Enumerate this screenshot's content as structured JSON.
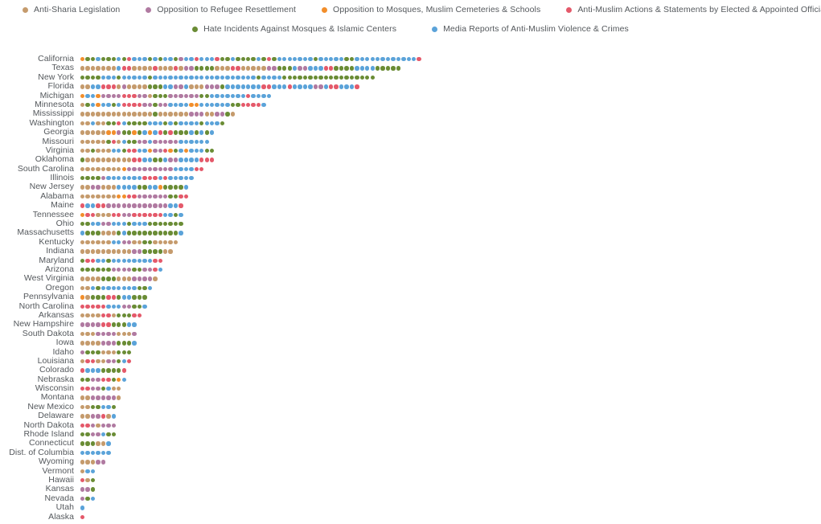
{
  "legend": {
    "rows": [
      [
        {
          "label": "Anti-Sharia Legislation",
          "key": "sharia",
          "color": "#c59b6d"
        },
        {
          "label": "Opposition to Refugee Resettlement",
          "key": "refugee",
          "color": "#b07aa1"
        },
        {
          "label": "Opposition to Mosques, Muslim Cemeteries & Schools",
          "key": "mosques",
          "color": "#f28e2b"
        },
        {
          "label": "Anti-Muslim Actions & Statements by Elected & Appointed Officials",
          "key": "officials",
          "color": "#e4596a"
        }
      ],
      [
        {
          "label": "Hate Incidents Against Mosques & Islamic Centers",
          "key": "hate",
          "color": "#6a8c35"
        },
        {
          "label": "Media Reports of Anti-Muslim Violence & Crimes",
          "key": "media",
          "color": "#5ba3d9"
        }
      ]
    ]
  },
  "chart_data": {
    "type": "bar",
    "subtype": "stacked-dot-plot",
    "title": "",
    "xlabel": "",
    "ylabel": "",
    "grid": false,
    "legend_position": "top",
    "dot_unit": 1,
    "series": [
      {
        "name": "Anti-Sharia Legislation",
        "key": "sharia",
        "color": "#c59b6d"
      },
      {
        "name": "Opposition to Refugee Resettlement",
        "key": "refugee",
        "color": "#b07aa1"
      },
      {
        "name": "Opposition to Mosques, Muslim Cemeteries & Schools",
        "key": "mosques",
        "color": "#f28e2b"
      },
      {
        "name": "Anti-Muslim Actions & Statements by Elected & Appointed Officials",
        "key": "officials",
        "color": "#e4596a"
      },
      {
        "name": "Hate Incidents Against Mosques & Islamic Centers",
        "key": "hate",
        "color": "#6a8c35"
      },
      {
        "name": "Media Reports of Anti-Muslim Violence & Crimes",
        "key": "media",
        "color": "#5ba3d9"
      }
    ],
    "categories": [
      "California",
      "Texas",
      "New York",
      "Florida",
      "Michigan",
      "Minnesota",
      "Mississippi",
      "Washington",
      "Georgia",
      "Missouri",
      "Virginia",
      "Oklahoma",
      "South Carolina",
      "Illinois",
      "New Jersey",
      "Alabama",
      "Maine",
      "Tennessee",
      "Ohio",
      "Massachusetts",
      "Kentucky",
      "Indiana",
      "Maryland",
      "Arizona",
      "West Virginia",
      "Oregon",
      "Pennsylvania",
      "North Carolina",
      "Arkansas",
      "New Hampshire",
      "South Dakota",
      "Iowa",
      "Idaho",
      "Louisiana",
      "Colorado",
      "Nebraska",
      "Wisconsin",
      "Montana",
      "New Mexico",
      "Delaware",
      "North Dakota",
      "Rhode Island",
      "Connecticut",
      "Dist. of Columbia",
      "Wyoming",
      "Vermont",
      "Hawaii",
      "Kansas",
      "Nevada",
      "Utah",
      "Alaska"
    ],
    "rows": [
      {
        "state": "California",
        "total": 66,
        "dots": "mosques,hate,hate,media,hate,hate,hate,media,hate,officials,media,media,media,hate,media,hate,media,media,hate,refugee,media,media,officials,media,media,media,officials,hate,hate,media,hate,hate,hate,hate,media,hate,officials,hate,media,media,media,media,media,media,media,hate,media,media,media,media,media,hate,hate,media,media,media,media,media,media,media,media,media,media,media,media,officials"
      },
      {
        "state": "Texas",
        "total": 62,
        "dots": "sharia,sharia,sharia,sharia,sharia,sharia,sharia,media,officials,officials,sharia,sharia,sharia,sharia,officials,sharia,sharia,sharia,officials,sharia,refugee,refugee,hate,hate,hate,hate,sharia,sharia,sharia,officials,officials,sharia,sharia,sharia,sharia,sharia,refugee,refugee,hate,hate,hate,media,refugee,refugee,media,media,media,officials,officials,hate,hate,hate,hate,media,media,media,media,hate,hate,hate,hate,hate"
      },
      {
        "state": "New York",
        "total": 57,
        "dots": "hate,hate,hate,hate,media,media,media,hate,media,media,media,media,media,hate,media,media,media,media,media,media,media,media,media,media,media,media,media,media,media,media,media,media,media,media,hate,media,media,media,media,hate,hate,hate,hate,hate,hate,hate,hate,hate,hate,hate,hate,hate,hate,hate,hate,hate,hate"
      },
      {
        "state": "Florida",
        "total": 54,
        "dots": "sharia,sharia,media,media,officials,officials,officials,sharia,refugee,sharia,sharia,sharia,sharia,hate,hate,hate,media,media,refugee,refugee,media,sharia,sharia,sharia,refugee,refugee,refugee,hate,media,media,media,media,media,media,media,officials,officials,media,media,media,officials,media,media,media,media,refugee,refugee,media,officials,officials,media,media,media,officials"
      },
      {
        "state": "Michigan",
        "total": 37,
        "dots": "mosques,media,media,mosques,refugee,refugee,refugee,refugee,officials,officials,officials,refugee,refugee,sharia,hate,hate,hate,refugee,refugee,refugee,refugee,refugee,refugee,hate,hate,media,media,media,media,media,media,media,officials,media,media,media,media"
      },
      {
        "state": "Minnesota",
        "total": 36,
        "dots": "sharia,hate,media,mosques,media,media,hate,media,officials,officials,officials,officials,refugee,refugee,hate,refugee,refugee,media,media,media,media,mosques,mosques,media,media,media,media,media,media,hate,hate,officials,officials,officials,officials,media"
      },
      {
        "state": "Mississippi",
        "total": 30,
        "dots": "sharia,sharia,sharia,sharia,sharia,sharia,sharia,sharia,sharia,sharia,sharia,sharia,sharia,sharia,hate,sharia,sharia,sharia,sharia,sharia,sharia,refugee,refugee,refugee,sharia,sharia,refugee,refugee,hate,sharia"
      },
      {
        "state": "Washington",
        "total": 28,
        "dots": "sharia,sharia,media,sharia,sharia,hate,hate,officials,media,hate,hate,hate,hate,media,media,media,hate,media,hate,media,media,media,media,hate,media,media,media,hate"
      },
      {
        "state": "Georgia",
        "total": 26,
        "dots": "sharia,sharia,sharia,sharia,sharia,mosques,mosques,refugee,hate,hate,mosques,hate,media,mosques,media,officials,hate,officials,hate,hate,hate,media,hate,media,hate,media"
      },
      {
        "state": "Missouri",
        "total": 25,
        "dots": "sharia,sharia,sharia,sharia,sharia,hate,officials,sharia,media,hate,hate,refugee,refugee,media,refugee,refugee,refugee,refugee,refugee,media,media,media,media,media,media"
      },
      {
        "state": "Virginia",
        "total": 26,
        "dots": "sharia,sharia,hate,sharia,sharia,sharia,media,media,hate,officials,officials,media,media,mosques,refugee,refugee,officials,mosques,hate,media,mosques,media,media,media,hate,hate"
      },
      {
        "state": "Oklahoma",
        "total": 26,
        "dots": "hate,sharia,sharia,sharia,sharia,sharia,sharia,sharia,sharia,sharia,officials,officials,media,media,hate,hate,media,refugee,refugee,media,media,media,media,officials,officials,officials"
      },
      {
        "state": "South Carolina",
        "total": 24,
        "dots": "sharia,sharia,sharia,sharia,sharia,sharia,sharia,sharia,mosques,refugee,refugee,refugee,refugee,refugee,refugee,refugee,refugee,refugee,media,media,media,media,officials,officials"
      },
      {
        "state": "Illinois",
        "total": 22,
        "dots": "hate,hate,hate,hate,refugee,media,media,media,media,media,media,media,officials,officials,officials,media,officials,media,media,media,media,media"
      },
      {
        "state": "New Jersey",
        "total": 21,
        "dots": "sharia,sharia,refugee,refugee,sharia,sharia,sharia,media,media,media,media,hate,hate,media,media,mosques,hate,hate,hate,hate,media"
      },
      {
        "state": "Alabama",
        "total": 21,
        "dots": "sharia,sharia,sharia,sharia,sharia,sharia,sharia,mosques,mosques,officials,officials,refugee,refugee,refugee,refugee,refugee,refugee,hate,hate,officials,officials"
      },
      {
        "state": "Maine",
        "total": 20,
        "dots": "officials,media,media,officials,officials,refugee,refugee,refugee,refugee,refugee,refugee,refugee,refugee,refugee,refugee,refugee,refugee,media,media,officials"
      },
      {
        "state": "Tennessee",
        "total": 20,
        "dots": "mosques,officials,officials,sharia,sharia,sharia,officials,officials,refugee,refugee,officials,officials,officials,officials,officials,officials,media,media,hate,media"
      },
      {
        "state": "Ohio",
        "total": 20,
        "dots": "hate,hate,media,media,refugee,refugee,media,media,media,hate,media,media,media,hate,hate,hate,hate,hate,hate,hate"
      },
      {
        "state": "Massachusetts",
        "total": 20,
        "dots": "media,hate,hate,hate,sharia,sharia,sharia,hate,media,hate,hate,hate,hate,hate,hate,hate,hate,hate,hate,media"
      },
      {
        "state": "Kentucky",
        "total": 19,
        "dots": "sharia,sharia,sharia,sharia,sharia,sharia,media,media,refugee,refugee,sharia,sharia,hate,hate,sharia,sharia,sharia,sharia,sharia"
      },
      {
        "state": "Indiana",
        "total": 18,
        "dots": "sharia,sharia,sharia,sharia,sharia,sharia,sharia,sharia,sharia,sharia,refugee,refugee,hate,hate,hate,hate,sharia,sharia"
      },
      {
        "state": "Maryland",
        "total": 16,
        "dots": "hate,officials,officials,media,media,hate,media,media,media,media,media,media,media,media,officials,officials"
      },
      {
        "state": "Arizona",
        "total": 16,
        "dots": "hate,hate,hate,hate,hate,hate,refugee,refugee,refugee,refugee,hate,hate,refugee,refugee,officials,media"
      },
      {
        "state": "West Virginia",
        "total": 15,
        "dots": "sharia,sharia,sharia,sharia,hate,hate,hate,sharia,sharia,sharia,refugee,refugee,refugee,refugee,sharia"
      },
      {
        "state": "Oregon",
        "total": 14,
        "dots": "sharia,sharia,media,hate,media,media,media,media,media,media,media,hate,hate,media"
      },
      {
        "state": "Pennsylvania",
        "total": 13,
        "dots": "mosques,sharia,hate,hate,hate,officials,officials,hate,media,media,hate,hate,hate"
      },
      {
        "state": "North Carolina",
        "total": 13,
        "dots": "officials,officials,officials,officials,officials,media,media,media,refugee,refugee,hate,hate,media"
      },
      {
        "state": "Arkansas",
        "total": 12,
        "dots": "sharia,sharia,sharia,sharia,officials,officials,sharia,hate,hate,hate,officials,officials"
      },
      {
        "state": "New Hampshire",
        "total": 11,
        "dots": "refugee,refugee,refugee,refugee,officials,officials,hate,hate,hate,media,media"
      },
      {
        "state": "South Dakota",
        "total": 11,
        "dots": "sharia,sharia,sharia,refugee,refugee,refugee,refugee,sharia,sharia,sharia,refugee"
      },
      {
        "state": "Iowa",
        "total": 11,
        "dots": "sharia,sharia,sharia,sharia,refugee,refugee,refugee,hate,hate,hate,media"
      },
      {
        "state": "Idaho",
        "total": 10,
        "dots": "refugee,hate,hate,hate,sharia,sharia,sharia,hate,hate,hate"
      },
      {
        "state": "Louisiana",
        "total": 10,
        "dots": "sharia,officials,officials,sharia,sharia,refugee,refugee,hate,media,officials"
      },
      {
        "state": "Colorado",
        "total": 9,
        "dots": "officials,media,media,media,hate,hate,hate,hate,officials"
      },
      {
        "state": "Nebraska",
        "total": 9,
        "dots": "hate,hate,refugee,refugee,officials,officials,hate,mosques,media"
      },
      {
        "state": "Wisconsin",
        "total": 8,
        "dots": "officials,officials,refugee,refugee,hate,media,sharia,sharia"
      },
      {
        "state": "Montana",
        "total": 8,
        "dots": "sharia,sharia,refugee,refugee,refugee,refugee,refugee,sharia"
      },
      {
        "state": "New Mexico",
        "total": 7,
        "dots": "sharia,sharia,hate,hate,media,media,hate"
      },
      {
        "state": "Delaware",
        "total": 7,
        "dots": "sharia,sharia,refugee,refugee,officials,sharia,media"
      },
      {
        "state": "North Dakota",
        "total": 7,
        "dots": "officials,officials,refugee,sharia,refugee,refugee,refugee"
      },
      {
        "state": "Rhode Island",
        "total": 7,
        "dots": "hate,hate,refugee,refugee,media,hate,hate"
      },
      {
        "state": "Connecticut",
        "total": 6,
        "dots": "hate,hate,hate,sharia,sharia,media"
      },
      {
        "state": "Dist. of Columbia",
        "total": 6,
        "dots": "media,media,media,media,media,media"
      },
      {
        "state": "Wyoming",
        "total": 5,
        "dots": "sharia,sharia,sharia,refugee,refugee"
      },
      {
        "state": "Vermont",
        "total": 3,
        "dots": "sharia,media,media"
      },
      {
        "state": "Hawaii",
        "total": 3,
        "dots": "officials,sharia,hate"
      },
      {
        "state": "Kansas",
        "total": 3,
        "dots": "refugee,refugee,hate"
      },
      {
        "state": "Nevada",
        "total": 3,
        "dots": "refugee,hate,media"
      },
      {
        "state": "Utah",
        "total": 1,
        "dots": "media"
      },
      {
        "state": "Alaska",
        "total": 1,
        "dots": "officials"
      }
    ]
  }
}
